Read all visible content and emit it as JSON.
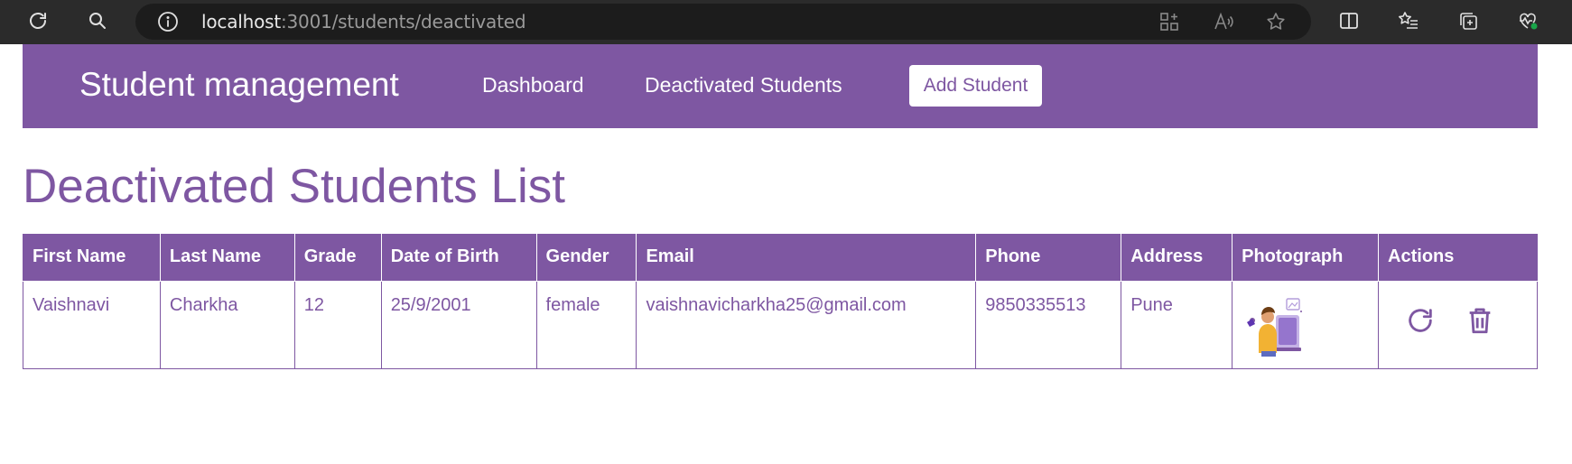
{
  "browser": {
    "url_host": "localhost",
    "url_rest": ":3001/students/deactivated",
    "icons": [
      "refresh-icon",
      "search-icon",
      "info-icon",
      "app-grid-icon",
      "read-aloud-icon",
      "favorite-star-icon",
      "split-screen-icon",
      "favorites-list-icon",
      "collections-icon",
      "browser-health-icon"
    ]
  },
  "nav": {
    "brand": "Student management",
    "links": [
      {
        "label": "Dashboard"
      },
      {
        "label": "Deactivated Students"
      }
    ],
    "add_button": "Add Student"
  },
  "page": {
    "title": "Deactivated Students List"
  },
  "table": {
    "headers": [
      "First Name",
      "Last Name",
      "Grade",
      "Date of Birth",
      "Gender",
      "Email",
      "Phone",
      "Address",
      "Photograph",
      "Actions"
    ],
    "rows": [
      {
        "first_name": "Vaishnavi",
        "last_name": "Charkha",
        "grade": "12",
        "dob": "25/9/2001",
        "gender": "female",
        "email": "vaishnavicharkha25@gmail.com",
        "phone": "9850335513",
        "address": "Pune",
        "actions": [
          "restore-icon",
          "delete-icon"
        ]
      }
    ]
  },
  "colors": {
    "accent": "#7e57a2",
    "chrome_bg": "#2b2b2b",
    "addr_bg": "#1c1c1c",
    "white": "#ffffff"
  }
}
